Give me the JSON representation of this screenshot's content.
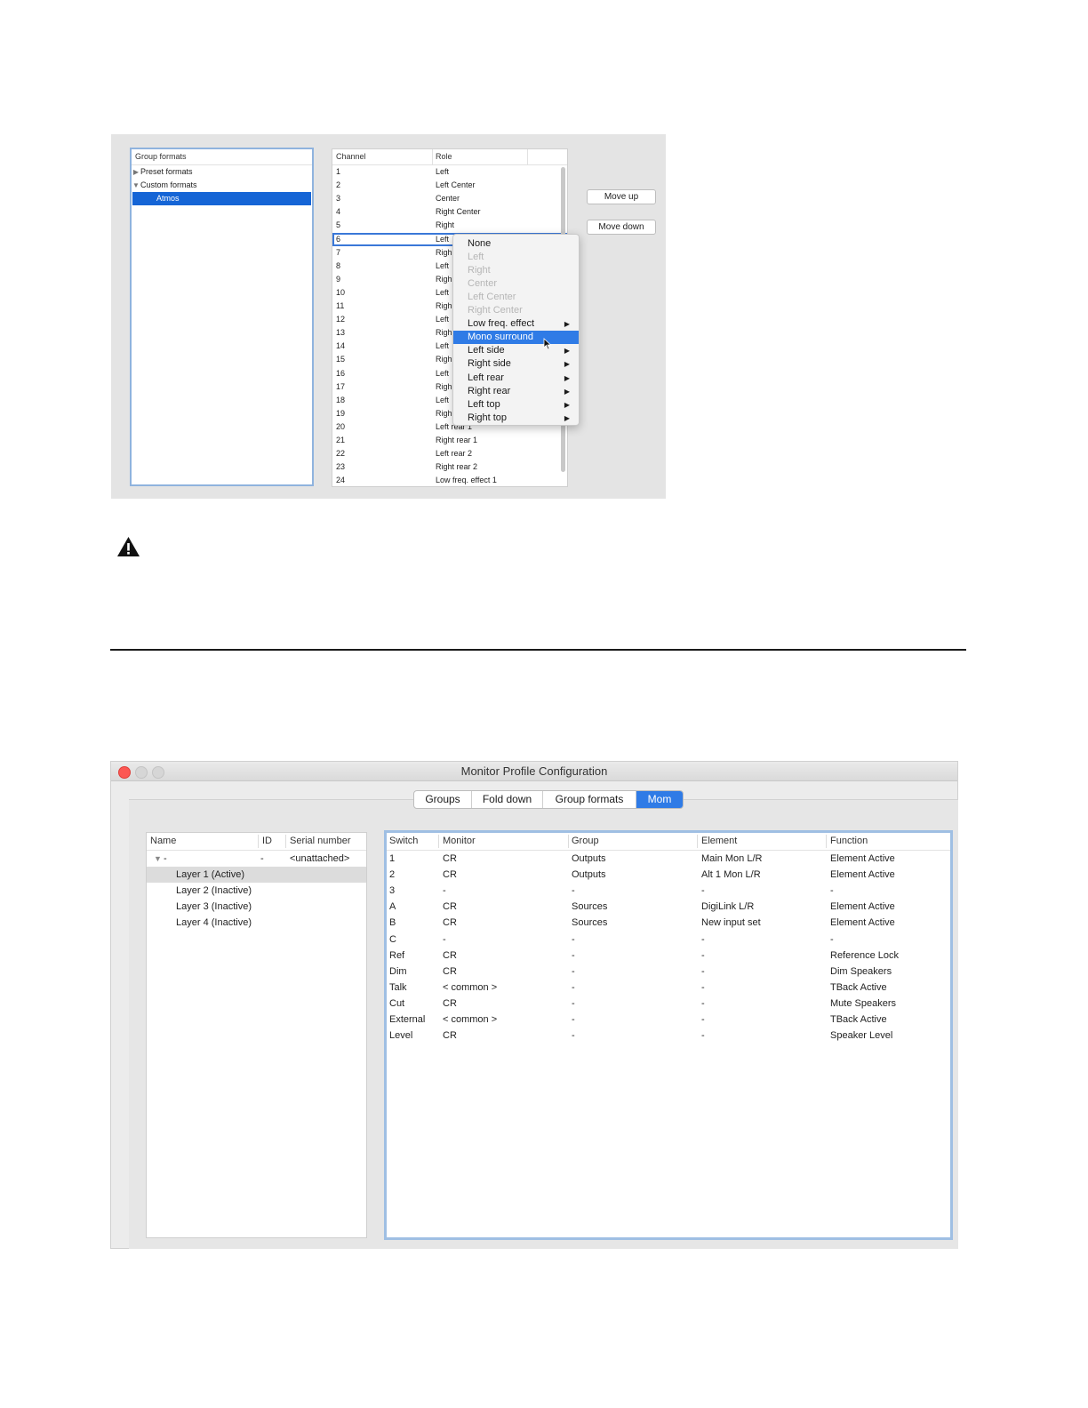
{
  "group_formats_dialog": {
    "group_formats_header": "Group formats",
    "tree": [
      {
        "label": "Preset formats",
        "expanded": false
      },
      {
        "label": "Custom formats",
        "expanded": true
      },
      {
        "label": "Atmos",
        "selected": true
      }
    ],
    "channel_table": {
      "headers": [
        "Channel",
        "Role"
      ],
      "rows": [
        [
          "1",
          "Left"
        ],
        [
          "2",
          "Left Center"
        ],
        [
          "3",
          "Center"
        ],
        [
          "4",
          "Right Center"
        ],
        [
          "5",
          "Right"
        ],
        [
          "6",
          "Left"
        ],
        [
          "7",
          "Righ"
        ],
        [
          "8",
          "Left"
        ],
        [
          "9",
          "Righ"
        ],
        [
          "10",
          "Left"
        ],
        [
          "11",
          "Righ"
        ],
        [
          "12",
          "Left"
        ],
        [
          "13",
          "Righ"
        ],
        [
          "14",
          "Left"
        ],
        [
          "15",
          "Righ"
        ],
        [
          "16",
          "Left"
        ],
        [
          "17",
          "Righ"
        ],
        [
          "18",
          "Left"
        ],
        [
          "19",
          "Righ"
        ],
        [
          "20",
          "Left rear 1"
        ],
        [
          "21",
          "Right rear 1"
        ],
        [
          "22",
          "Left rear 2"
        ],
        [
          "23",
          "Right rear 2"
        ],
        [
          "24",
          "Low freq. effect 1"
        ]
      ],
      "selected_channel": "6"
    },
    "buttons": {
      "move_up": "Move up",
      "move_down": "Move down"
    },
    "context_menu": [
      {
        "label": "None",
        "disabled": false,
        "submenu": false
      },
      {
        "label": "Left",
        "disabled": true,
        "submenu": false
      },
      {
        "label": "Right",
        "disabled": true,
        "submenu": false
      },
      {
        "label": "Center",
        "disabled": true,
        "submenu": false
      },
      {
        "label": "Left Center",
        "disabled": true,
        "submenu": false
      },
      {
        "label": "Right Center",
        "disabled": true,
        "submenu": false
      },
      {
        "label": "Low freq. effect",
        "disabled": false,
        "submenu": true
      },
      {
        "label": "Mono surround",
        "disabled": false,
        "submenu": false,
        "highlighted": true
      },
      {
        "label": "Left side",
        "disabled": false,
        "submenu": true
      },
      {
        "label": "Right side",
        "disabled": false,
        "submenu": true
      },
      {
        "label": "Left rear",
        "disabled": false,
        "submenu": true
      },
      {
        "label": "Right rear",
        "disabled": false,
        "submenu": true
      },
      {
        "label": "Left top",
        "disabled": false,
        "submenu": true
      },
      {
        "label": "Right top",
        "disabled": false,
        "submenu": true
      }
    ]
  },
  "monitor_profile_window": {
    "title": "Monitor Profile Configuration",
    "tabs": [
      {
        "label": "Groups",
        "active": false
      },
      {
        "label": "Fold down",
        "active": false
      },
      {
        "label": "Group formats",
        "active": false
      },
      {
        "label": "Mom",
        "active": true
      }
    ],
    "device_table": {
      "headers": [
        "Name",
        "ID",
        "Serial number"
      ],
      "device_row": {
        "name": "-",
        "id": "-",
        "serial": "<unattached>"
      },
      "layers": [
        {
          "label": "Layer 1 (Active)",
          "selected": true
        },
        {
          "label": "Layer 2 (Inactive)",
          "selected": false
        },
        {
          "label": "Layer 3 (Inactive)",
          "selected": false
        },
        {
          "label": "Layer 4 (Inactive)",
          "selected": false
        }
      ]
    },
    "switch_table": {
      "headers": [
        "Switch",
        "Monitor",
        "Group",
        "Element",
        "Function"
      ],
      "rows": [
        [
          "1",
          "CR",
          "Outputs",
          "Main Mon L/R",
          "Element Active"
        ],
        [
          "2",
          "CR",
          "Outputs",
          "Alt 1 Mon L/R",
          "Element Active"
        ],
        [
          "3",
          "-",
          "-",
          "-",
          "-"
        ],
        [
          "A",
          "CR",
          "Sources",
          "DigiLink L/R",
          "Element Active"
        ],
        [
          "B",
          "CR",
          "Sources",
          "New input set",
          "Element Active"
        ],
        [
          "C",
          "-",
          "-",
          "-",
          "-"
        ],
        [
          "Ref",
          "CR",
          "-",
          "-",
          "Reference Lock"
        ],
        [
          "Dim",
          "CR",
          "-",
          "-",
          "Dim Speakers"
        ],
        [
          "Talk",
          "< common >",
          "-",
          "-",
          "TBack Active"
        ],
        [
          "Cut",
          "CR",
          "-",
          "-",
          "Mute Speakers"
        ],
        [
          "External",
          "< common >",
          "-",
          "-",
          "TBack Active"
        ],
        [
          "Level",
          "CR",
          "-",
          "-",
          "Speaker Level"
        ]
      ]
    }
  },
  "colors": {
    "selection_blue": "#1565d6",
    "menu_highlight": "#2f7be6",
    "focus_ring": "#9fbfe3",
    "close_red": "#fc5753"
  },
  "icons": {
    "warning": "warning-triangle-icon",
    "cursor": "mouse-pointer-icon"
  }
}
